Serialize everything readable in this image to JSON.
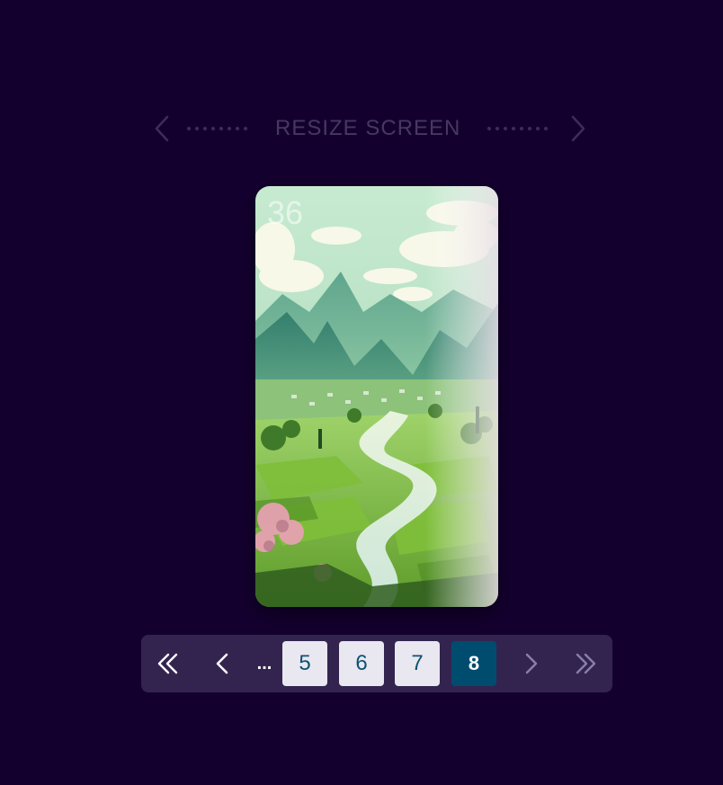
{
  "topbar": {
    "label": "RESIZE SCREEN"
  },
  "card": {
    "number": "36",
    "image_description_icon": "landscape-illustration-icon"
  },
  "pagination": {
    "ellipsis": "...",
    "pages": [
      "5",
      "6",
      "7",
      "8"
    ],
    "active_page": "8"
  },
  "colors": {
    "background": "#14002f",
    "pager_bg": "#33244f",
    "active_page_bg": "#004c6e",
    "page_bg": "#e9e7ef",
    "page_text": "#0e5272",
    "topbar_muted": "#45395f"
  }
}
